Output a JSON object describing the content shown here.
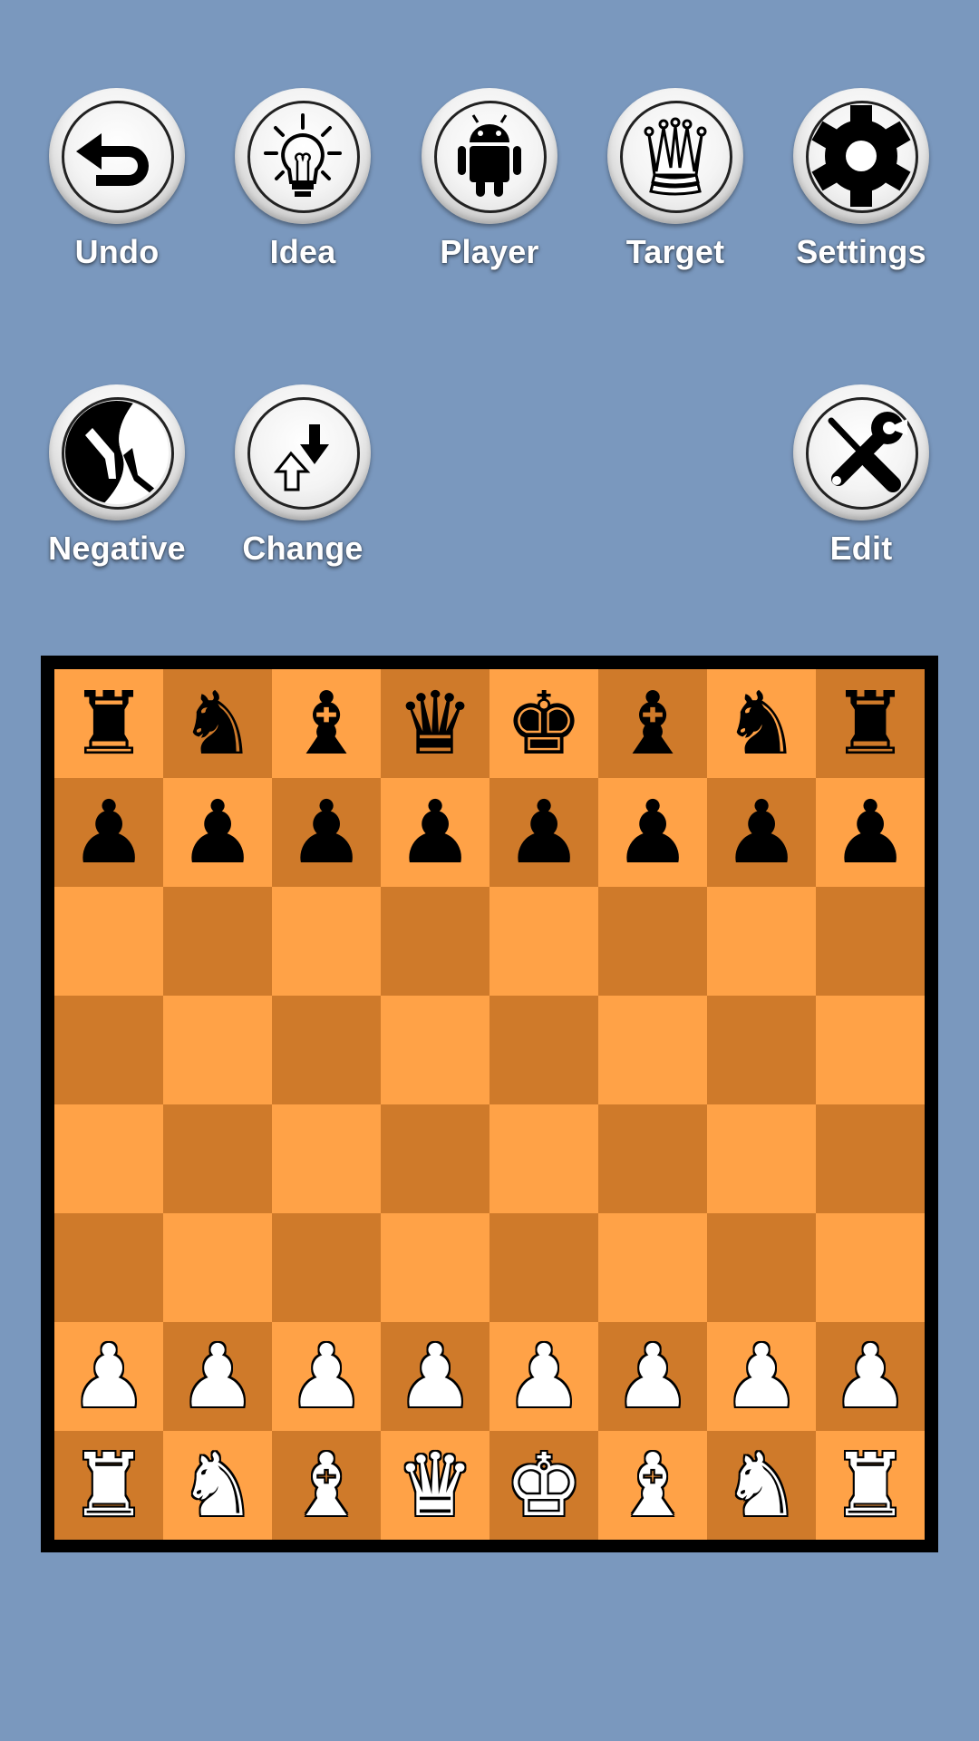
{
  "toolbar": {
    "row1": [
      {
        "id": "undo",
        "label": "Undo",
        "icon": "undo-arrow-icon"
      },
      {
        "id": "idea",
        "label": "Idea",
        "icon": "lightbulb-icon"
      },
      {
        "id": "player",
        "label": "Player",
        "icon": "android-robot-icon"
      },
      {
        "id": "target",
        "label": "Target",
        "icon": "queen-crown-icon"
      },
      {
        "id": "settings",
        "label": "Settings",
        "icon": "gear-icon"
      }
    ],
    "row2": [
      {
        "id": "negative",
        "label": "Negative",
        "icon": "hands-yin-yang-icon"
      },
      {
        "id": "change",
        "label": "Change",
        "icon": "swap-arrows-icon"
      },
      {
        "id": "edit",
        "label": "Edit",
        "icon": "wrench-screwdriver-icon"
      }
    ]
  },
  "colors": {
    "background": "#7a98be",
    "light_square": "#ffa247",
    "dark_square": "#cf7a2a",
    "board_frame": "#000000"
  },
  "board": {
    "orientation": "white-at-bottom",
    "ranks": [
      [
        "r",
        "n",
        "b",
        "q",
        "k",
        "b",
        "n",
        "r"
      ],
      [
        "p",
        "p",
        "p",
        "p",
        "p",
        "p",
        "p",
        "p"
      ],
      [
        "",
        "",
        "",
        "",
        "",
        "",
        "",
        ""
      ],
      [
        "",
        "",
        "",
        "",
        "",
        "",
        "",
        ""
      ],
      [
        "",
        "",
        "",
        "",
        "",
        "",
        "",
        ""
      ],
      [
        "",
        "",
        "",
        "",
        "",
        "",
        "",
        ""
      ],
      [
        "P",
        "P",
        "P",
        "P",
        "P",
        "P",
        "P",
        "P"
      ],
      [
        "R",
        "N",
        "B",
        "Q",
        "K",
        "B",
        "N",
        "R"
      ]
    ],
    "glyphs": {
      "k": "♚",
      "q": "♛",
      "r": "♜",
      "b": "♝",
      "n": "♞",
      "p": "♟",
      "K": "♚",
      "Q": "♛",
      "R": "♜",
      "B": "♝",
      "N": "♞",
      "P": "♟"
    },
    "names": {
      "k": "black-king",
      "q": "black-queen",
      "r": "black-rook",
      "b": "black-bishop",
      "n": "black-knight",
      "p": "black-pawn",
      "K": "white-king",
      "Q": "white-queen",
      "R": "white-rook",
      "B": "white-bishop",
      "N": "white-knight",
      "P": "white-pawn"
    }
  }
}
